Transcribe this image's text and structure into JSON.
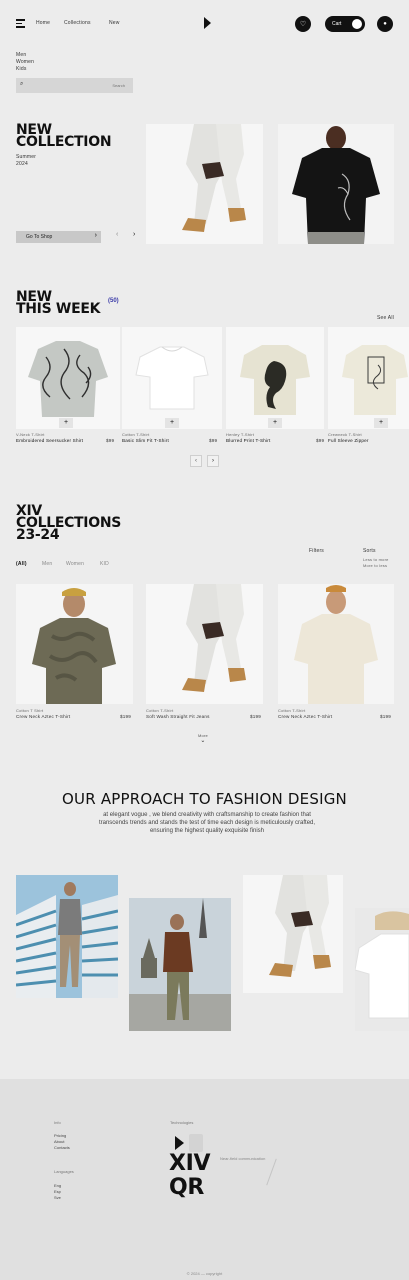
{
  "nav": {
    "links": [
      "Home",
      "Collections",
      "New"
    ],
    "cart_label": "Cart"
  },
  "sidebar": {
    "categories": [
      "Men",
      "Women",
      "Kids"
    ]
  },
  "search": {
    "placeholder": "Search"
  },
  "hero": {
    "title_line1": "NEW",
    "title_line2": "COLLECTION",
    "subtitle_line1": "Summer",
    "subtitle_line2": "2024",
    "cta_label": "Go To Shop"
  },
  "new_week": {
    "title_line1": "NEW",
    "title_line2": "THIS WEEK",
    "count": "(50)",
    "see_all": "See All",
    "products": [
      {
        "category": "V-Neck T-Shirt",
        "name": "Embroidered Seersucker Shirt",
        "price": "$99"
      },
      {
        "category": "Cotton T-Shirt",
        "name": "Basic Slim Fit T-Shirt",
        "price": "$99"
      },
      {
        "category": "Henley T-Shirt",
        "name": "Blurred Print T-Shirt",
        "price": "$99"
      },
      {
        "category": "Crewneck T-Shirt",
        "name": "Full Sleeve Zipper",
        "price": "$99"
      }
    ]
  },
  "collections": {
    "title_line1": "XIV",
    "title_line2": "COLLECTIONS",
    "title_line3": "23-24",
    "tabs": [
      "(All)",
      "Men",
      "Women",
      "KID"
    ],
    "filters_label": "Filters",
    "sort_label": "Sorts",
    "sort_options": [
      "Less to more",
      "More to less"
    ],
    "products": [
      {
        "category": "Cotton T Shirt",
        "name": "Crew Neck Aztec T-Shirt",
        "price": "$199"
      },
      {
        "category": "Cotton T-Shirt",
        "name": "Soft Wash Straight Fit Jeans",
        "price": "$199"
      },
      {
        "category": "Cotton T-Shirt",
        "name": "Crew Neck Aztec T-Shirt",
        "price": "$199"
      }
    ],
    "more_label": "More"
  },
  "approach": {
    "title": "OUR APPROACH TO FASHION DESIGN",
    "body": "at elegant vogue , we blend creativity with craftsmanship to create fashion that transcends trends and stands the test of time each design is meticulously crafted, ensuring the highest quality exquisite finish"
  },
  "footer": {
    "col1_heading": "Info",
    "col1_links": [
      "Pricing",
      "About",
      "Contacts"
    ],
    "col2_heading": "Languages",
    "col2_links": [
      "Eng",
      "Esp",
      "Sve"
    ],
    "tech_label": "Technologies",
    "brand_line1": "XIV",
    "brand_line2": "QR",
    "tagline": "Near-field communication",
    "copyright": "© 2024 — copyright"
  },
  "colors": {
    "accent": "#3a3aa8",
    "dark": "#111111",
    "bg": "#ececec"
  }
}
